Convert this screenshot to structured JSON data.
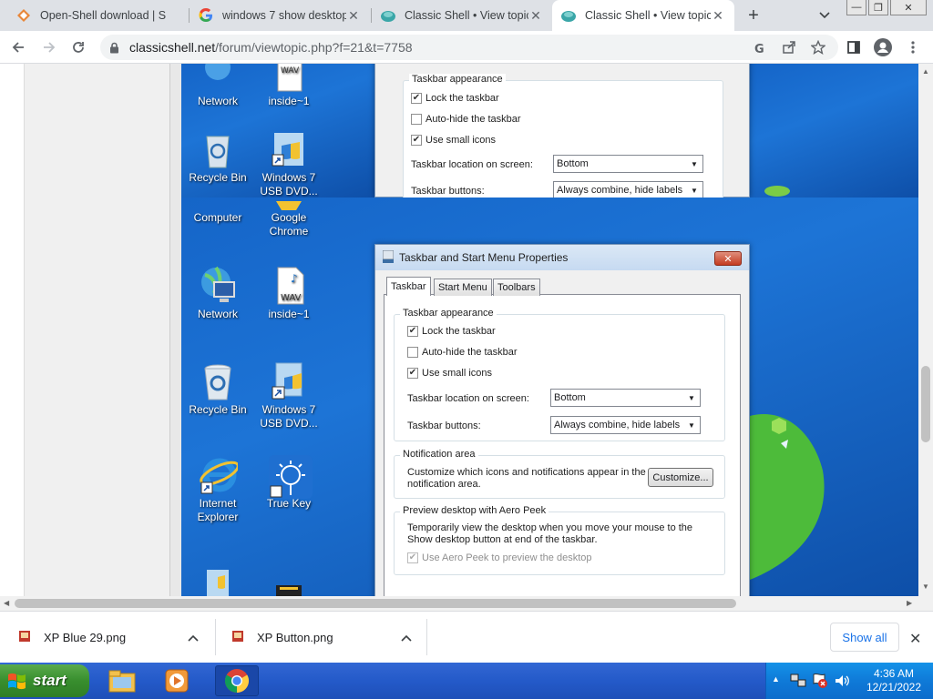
{
  "browser": {
    "tabs": [
      {
        "title": "Open-Shell download | S",
        "icon": "open-shell-icon"
      },
      {
        "title": "windows 7 show desktop",
        "icon": "google-icon"
      },
      {
        "title": "Classic Shell • View topic",
        "icon": "classic-shell-icon"
      },
      {
        "title": "Classic Shell • View topic",
        "icon": "classic-shell-icon",
        "active": true
      }
    ],
    "url_domain": "classicshell.net",
    "url_path": "/forum/viewtopic.php?f=21&t=7758"
  },
  "desktop_top": {
    "icons": [
      {
        "label": "Network"
      },
      {
        "label": "inside~1"
      },
      {
        "label": "Recycle Bin"
      },
      {
        "label": "Windows 7 USB DVD..."
      },
      {
        "label": "Computer"
      },
      {
        "label": "Google Chrome"
      }
    ]
  },
  "desktop_main": {
    "icons": [
      {
        "label": "Network"
      },
      {
        "label": "inside~1"
      },
      {
        "label": "Recycle Bin"
      },
      {
        "label": "Windows 7 USB DVD..."
      },
      {
        "label": "Internet Explorer"
      },
      {
        "label": "True Key"
      }
    ],
    "wav_text": "WAV"
  },
  "dialog": {
    "title": "Taskbar and Start Menu Properties",
    "close": "✕",
    "tabs": [
      "Taskbar",
      "Start Menu",
      "Toolbars"
    ],
    "appearance_group": "Taskbar appearance",
    "lock": "Lock the taskbar",
    "autohide": "Auto-hide the taskbar",
    "small_icons": "Use small icons",
    "location_label": "Taskbar location on screen:",
    "location_value": "Bottom",
    "buttons_label": "Taskbar buttons:",
    "buttons_value": "Always combine, hide labels",
    "notif_group": "Notification area",
    "notif_text": "Customize which icons and notifications appear in the notification area.",
    "customize": "Customize...",
    "peek_group": "Preview desktop with Aero Peek",
    "peek_text": "Temporarily view the desktop when you move your mouse to the Show desktop button at end of the taskbar.",
    "peek_check": "Use Aero Peek to preview the desktop"
  },
  "downloads": [
    {
      "name": "XP Blue 29.png"
    },
    {
      "name": "XP Button.png"
    }
  ],
  "show_all": "Show all",
  "taskbar": {
    "start": "start",
    "time": "4:36 AM",
    "date": "12/21/2022"
  },
  "colors": {
    "xp_taskbar": "#245ac9",
    "start_green": "#388e2e",
    "win7_blue": "#1565c8"
  }
}
